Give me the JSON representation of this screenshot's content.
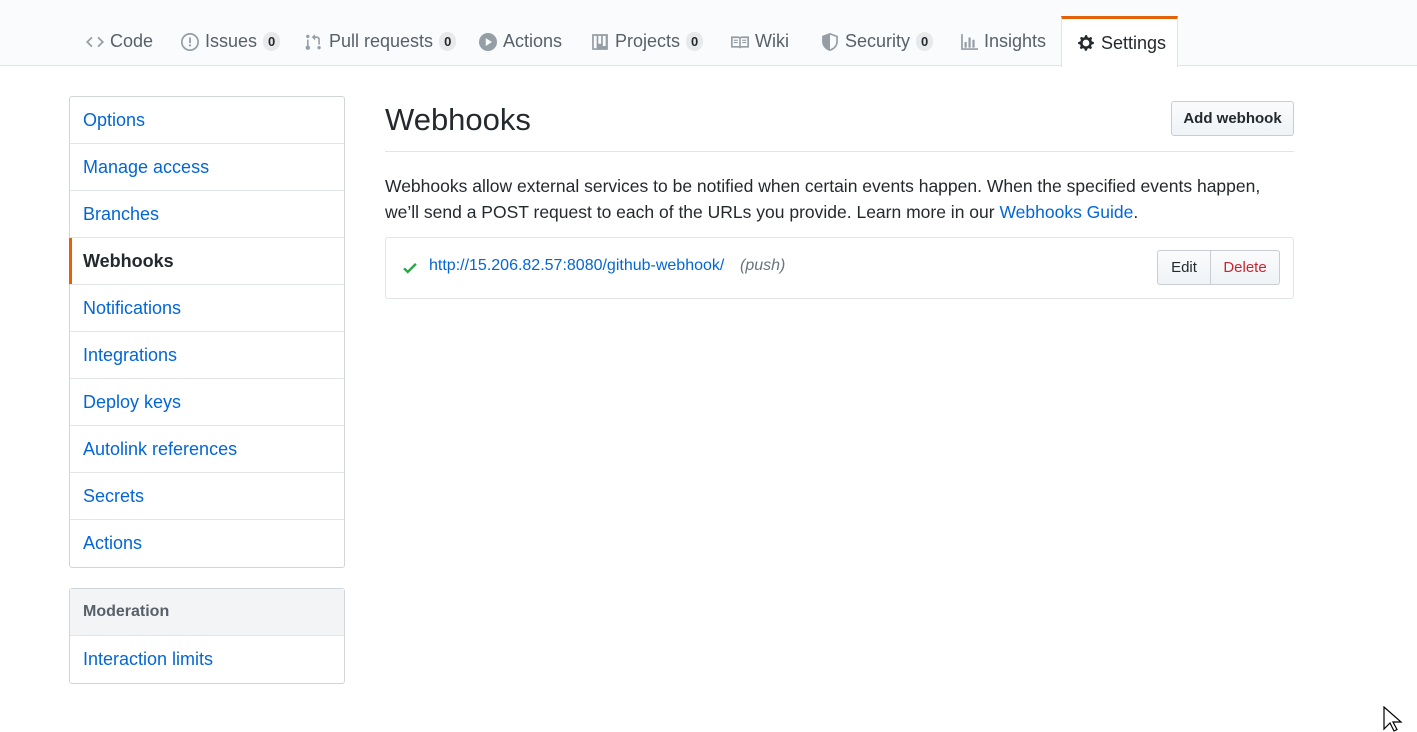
{
  "reponav": {
    "code": "Code",
    "issues": "Issues",
    "issues_count": "0",
    "pull_requests": "Pull requests",
    "pull_requests_count": "0",
    "actions": "Actions",
    "projects": "Projects",
    "projects_count": "0",
    "wiki": "Wiki",
    "security": "Security",
    "security_count": "0",
    "insights": "Insights",
    "settings": "Settings"
  },
  "sidebar": {
    "items": [
      {
        "label": "Options"
      },
      {
        "label": "Manage access"
      },
      {
        "label": "Branches"
      },
      {
        "label": "Webhooks",
        "selected": true
      },
      {
        "label": "Notifications"
      },
      {
        "label": "Integrations"
      },
      {
        "label": "Deploy keys"
      },
      {
        "label": "Autolink references"
      },
      {
        "label": "Secrets"
      },
      {
        "label": "Actions"
      }
    ],
    "moderation": {
      "heading": "Moderation",
      "items": [
        {
          "label": "Interaction limits"
        }
      ]
    }
  },
  "main": {
    "title": "Webhooks",
    "add_button": "Add webhook",
    "description": "Webhooks allow external services to be notified when certain events happen. When the specified events happen, we’ll send a POST request to each of the URLs you provide. Learn more in our ",
    "guide_link": "Webhooks Guide",
    "description_end": ".",
    "webhooks": [
      {
        "url": "http://15.206.82.57:8080/github-webhook/",
        "events": "(push)",
        "status": "success",
        "edit_label": "Edit",
        "delete_label": "Delete"
      }
    ]
  },
  "colors": {
    "accent": "#e36209",
    "link": "#0366d6",
    "danger": "#cb2431",
    "success": "#28a745"
  }
}
